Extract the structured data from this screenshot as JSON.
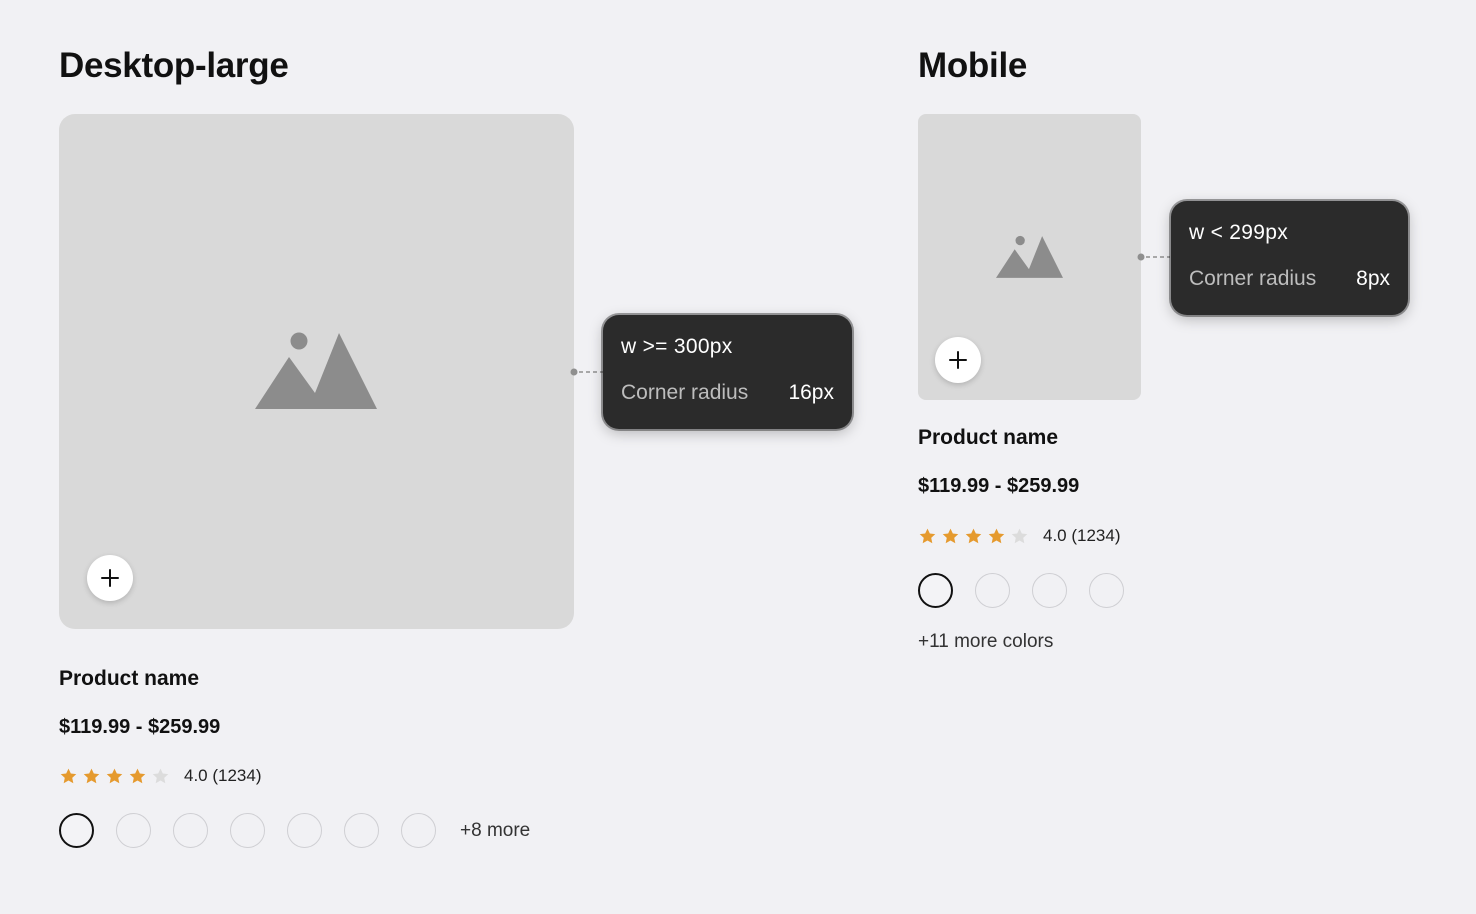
{
  "desktop": {
    "title": "Desktop-large",
    "image_icon": "image-placeholder-icon",
    "add_icon": "plus-icon",
    "add_label": "+",
    "product_name": "Product name",
    "price": "$119.99 - $259.99",
    "rating": {
      "value": 4.0,
      "max": 5,
      "text": "4.0 (1234)"
    },
    "swatches_count": 7,
    "more_label": "+8 more",
    "tooltip": {
      "condition": "w >= 300px",
      "label": "Corner radius",
      "value": "16px"
    }
  },
  "mobile": {
    "title": "Mobile",
    "image_icon": "image-placeholder-icon",
    "add_icon": "plus-icon",
    "add_label": "+",
    "product_name": "Product name",
    "price": "$119.99 - $259.99",
    "rating": {
      "value": 4.0,
      "max": 5,
      "text": "4.0 (1234)"
    },
    "swatches_count": 4,
    "more_label": "+11 more colors",
    "tooltip": {
      "condition": "w < 299px",
      "label": "Corner radius",
      "value": "8px"
    }
  },
  "colors": {
    "background": "#f1f1f4",
    "image_placeholder": "#d9d9d9",
    "icon_gray": "#8c8c8c",
    "star_filled": "#e59a2e",
    "star_empty": "#dcdcdc",
    "tooltip_bg": "#2b2b2b"
  }
}
